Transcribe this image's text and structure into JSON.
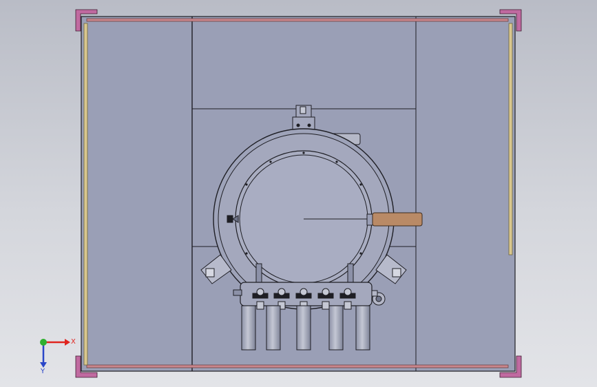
{
  "view": {
    "type": "cad-drawing-front-view",
    "colors": {
      "background_top": "#b9bcc6",
      "background_bottom": "#e3e4e8",
      "panel": "#9a9fb6",
      "panel_dark": "#8d92a9",
      "line": "#1e1e24",
      "frame_top_bottom": "#c9868c",
      "frame_sides": "#d9c78e",
      "corner_bracket": "#c06aa0",
      "heater_rod": "#b98a66",
      "pipe": "#a9adba",
      "vessel": "#a4a8bd"
    }
  },
  "triad": {
    "x_label": "X",
    "y_label": "Y",
    "x_color": "#e0241e",
    "y_color": "#2a46c8",
    "origin_color": "#2fb02f"
  },
  "outlet_pipes": {
    "count": 5
  },
  "clamp_fittings": {
    "count": 5
  }
}
